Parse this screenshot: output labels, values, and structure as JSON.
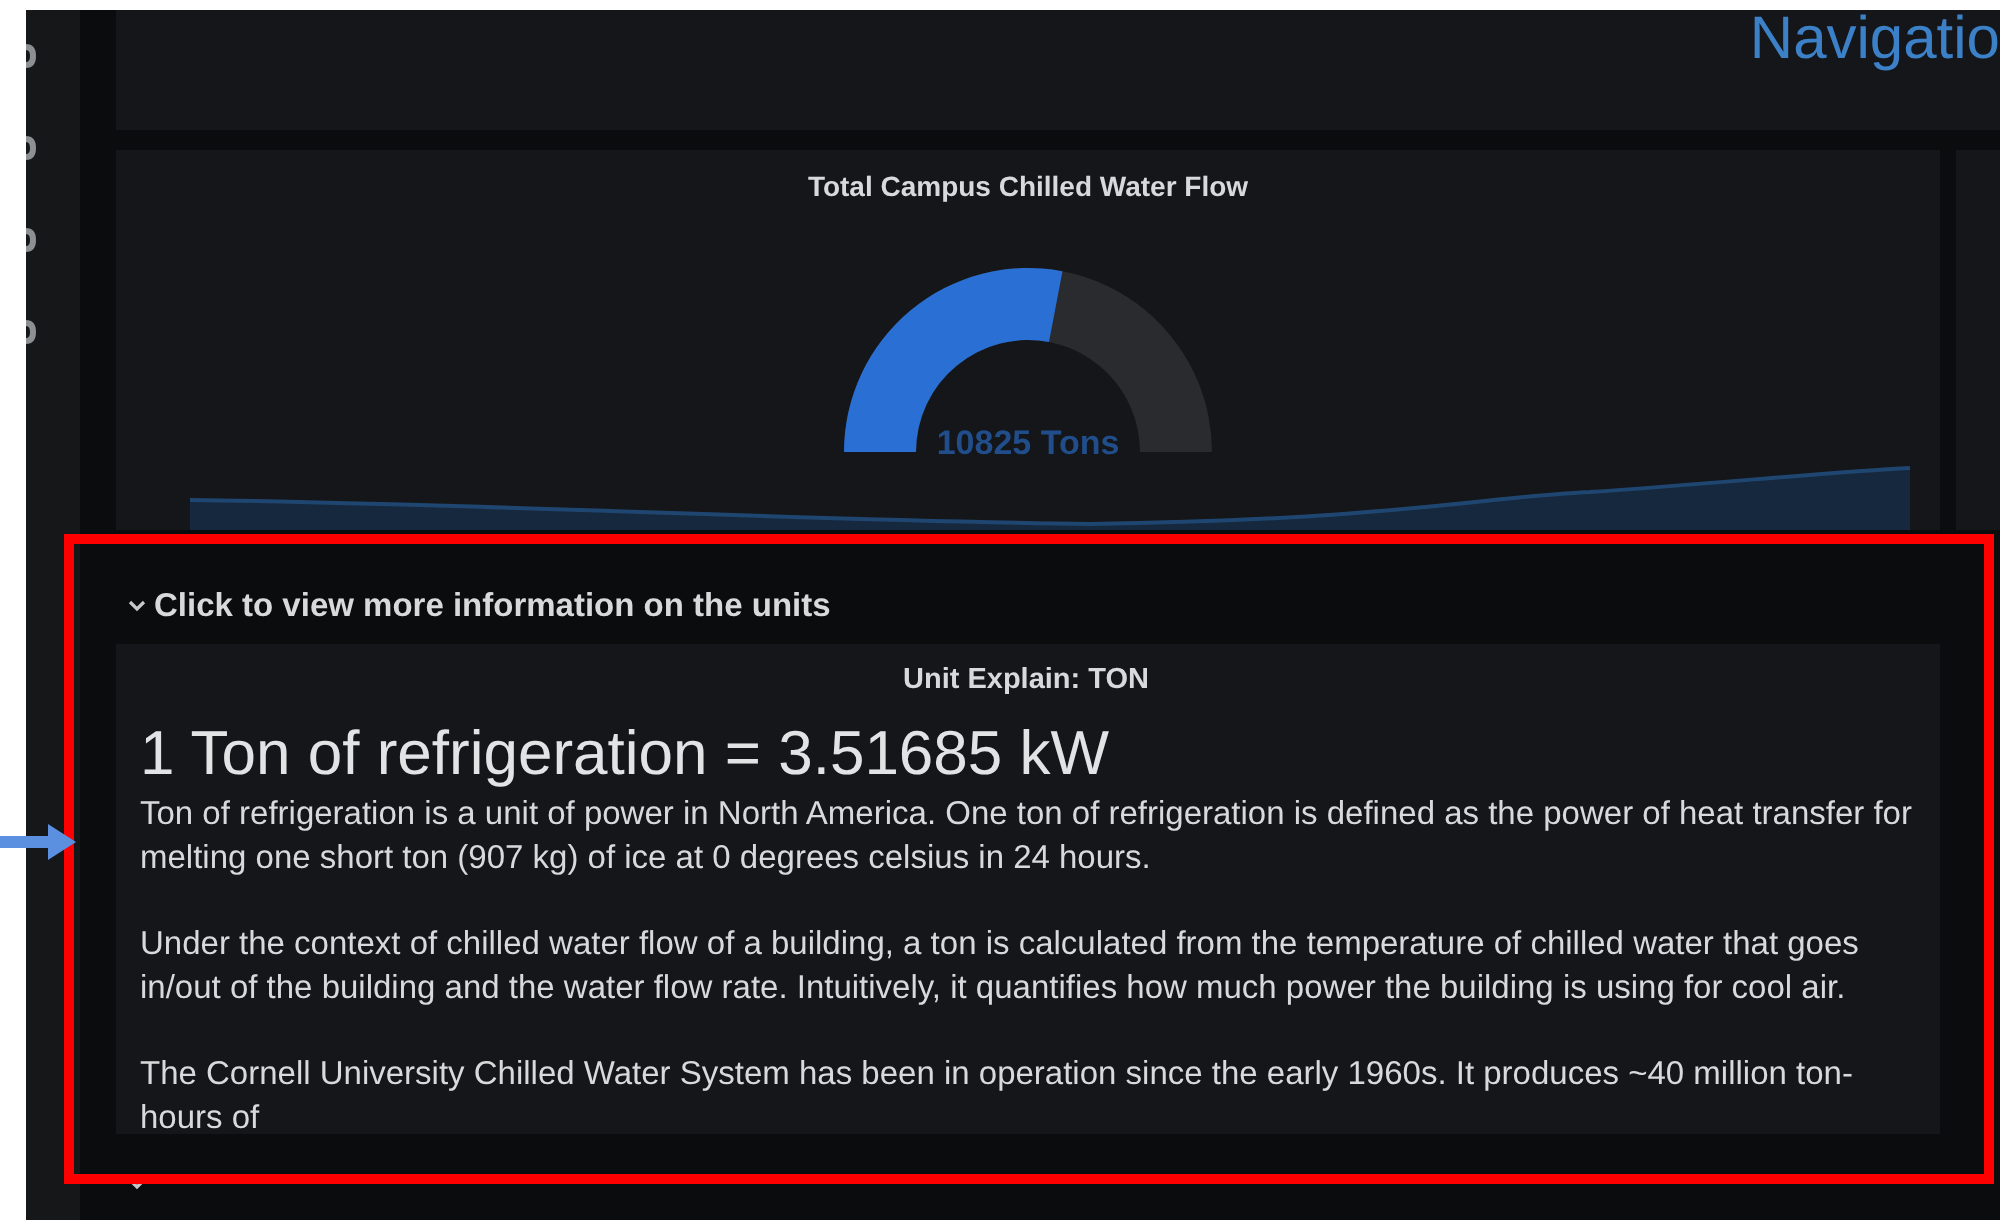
{
  "header": {
    "title": "Navigatio"
  },
  "gauge_panel": {
    "title": "Total Campus Chilled Water Flow",
    "value": "10825 Tons"
  },
  "info_row": {
    "title": "Click to view more information on the units",
    "panel": {
      "title": "Unit Explain: TON",
      "heading": "1 Ton of refrigeration = 3.51685 kW",
      "paragraphs": [
        "Ton of refrigeration is a unit of power in North America. One ton of refrigeration is defined as the power of heat transfer for melting one short ton (907 kg) of ice at 0 degrees celsius in 24 hours.",
        "Under the context of chilled water flow of a building, a ton is calculated from the temperature of chilled water that goes in/out of the building and the water flow rate. Intuitively, it quantifies how much power the building is using for cool air.",
        "The Cornell University Chilled Water System has been in operation since the early 1960s. It produces ~40 million ton-hours of"
      ]
    }
  }
}
